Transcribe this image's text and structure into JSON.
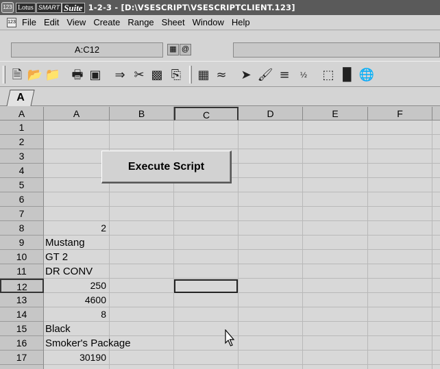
{
  "window": {
    "brand_lotus": "Lotus",
    "brand_smart": "SMART",
    "brand_suite": "Suite",
    "app_icon_text": "123",
    "title": "1-2-3 - [D:\\VSESCRIPT\\VSESCRIPTCLIENT.123]"
  },
  "menu": {
    "items": [
      "File",
      "Edit",
      "View",
      "Create",
      "Range",
      "Sheet",
      "Window",
      "Help"
    ]
  },
  "edit_line": {
    "cell_address": "A:C12",
    "contents": ""
  },
  "toolbar": {
    "icons": [
      "new-document-icon",
      "open-file-icon",
      "save-icon",
      "print-icon",
      "print-preview-icon",
      "undo-icon",
      "cut-icon",
      "copy-icon",
      "paste-icon",
      "sum-icon",
      "format-icon",
      "chart-icon",
      "arrow-right-icon",
      "paint-format-icon",
      "align-icon",
      "fraction-icon",
      "select-icon",
      "bar-chart-icon",
      "globe-icon"
    ]
  },
  "sheet_tab": {
    "label": "A"
  },
  "grid": {
    "corner": "A",
    "columns": [
      "A",
      "B",
      "C",
      "D",
      "E",
      "F"
    ],
    "rows": [
      "1",
      "2",
      "3",
      "4",
      "5",
      "6",
      "7",
      "8",
      "9",
      "10",
      "11",
      "12",
      "13",
      "14",
      "15",
      "16",
      "17"
    ],
    "selected_column": "C",
    "selected_row": "12",
    "cells": {
      "a8": "2",
      "a9": "Mustang",
      "a10": "GT 2",
      "a11": "DR CONV",
      "a12": "250",
      "a13": "4600",
      "a14": "8",
      "a15": "Black",
      "a16": "Smoker's Package",
      "a17": "30190"
    }
  },
  "button": {
    "label": "Execute Script"
  }
}
